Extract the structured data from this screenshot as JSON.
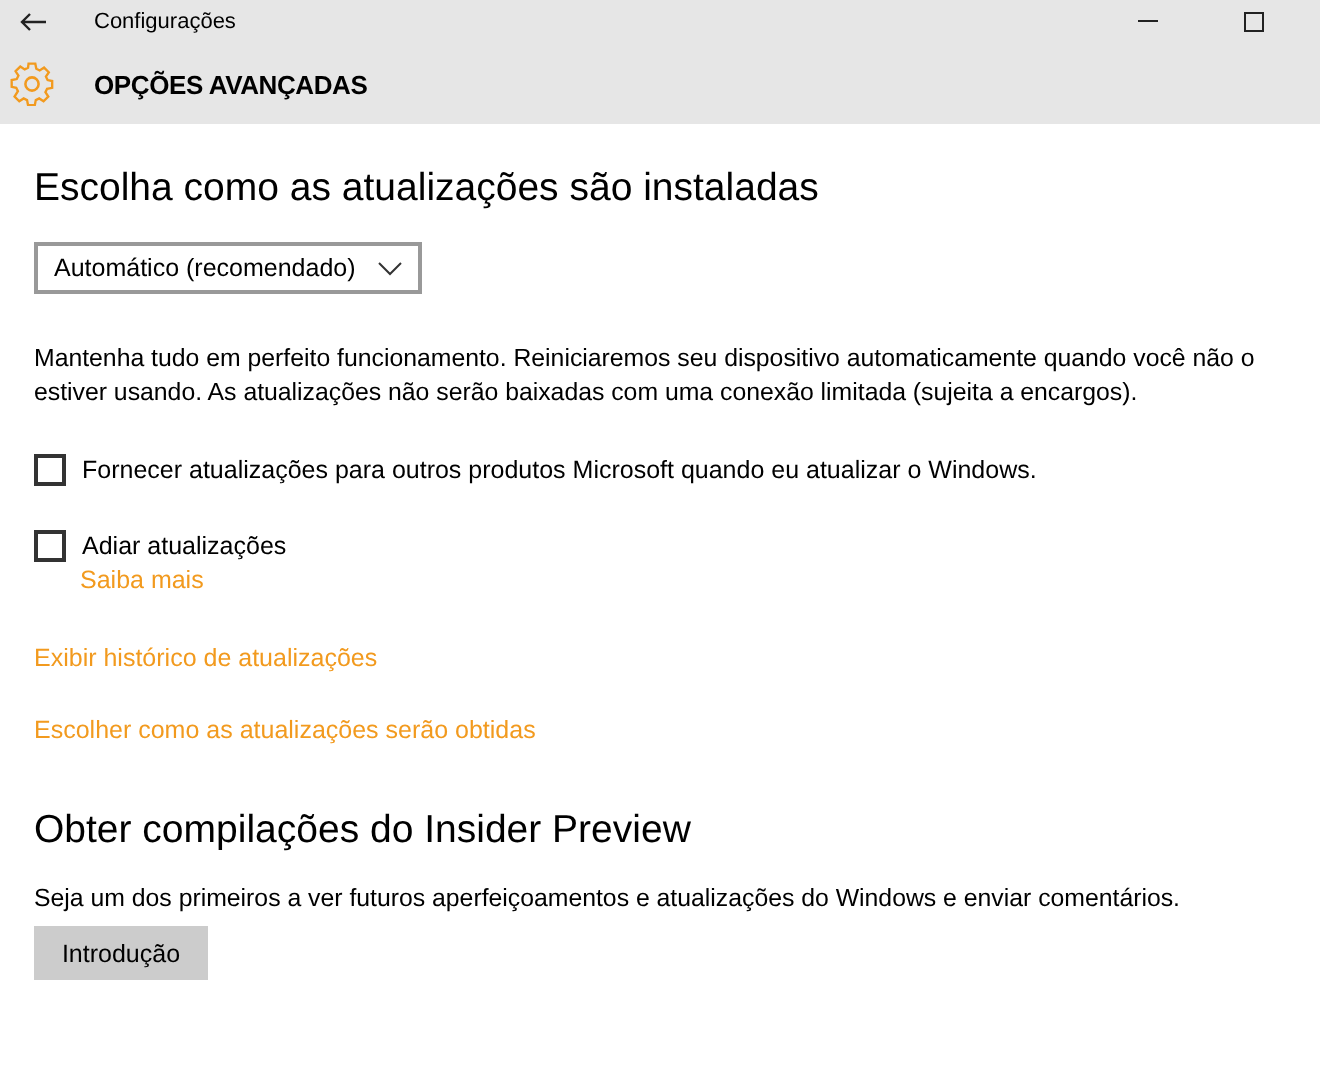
{
  "window": {
    "title": "Configurações"
  },
  "header": {
    "title": "OPÇÕES AVANÇADAS"
  },
  "updates": {
    "heading": "Escolha como as atualizações são instaladas",
    "dropdown": {
      "value": "Automático (recomendado)"
    },
    "description": "Mantenha tudo em perfeito funcionamento. Reiniciaremos seu dispositivo automaticamente quando você não o estiver usando. As atualizações não serão baixadas com uma conexão limitada (sujeita a encargos).",
    "options": [
      {
        "label": "Fornecer atualizações para outros produtos Microsoft quando eu atualizar o Windows.",
        "checked": false
      },
      {
        "label": "Adiar atualizações",
        "checked": false,
        "link": "Saiba mais"
      }
    ],
    "links": [
      "Exibir histórico de atualizações",
      "Escolher como as atualizações serão obtidas"
    ]
  },
  "insider": {
    "heading": "Obter compilações do Insider Preview",
    "description": "Seja um dos primeiros a ver futuros aperfeiçoamentos e atualizações do Windows e enviar comentários.",
    "button": "Introdução"
  }
}
